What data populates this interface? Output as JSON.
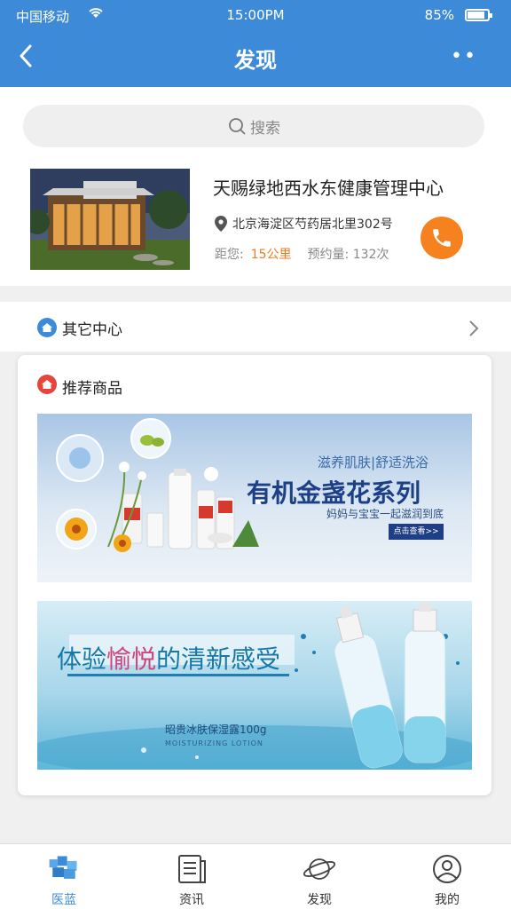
{
  "status_bar": {
    "carrier": "中国移动",
    "time": "15:00PM",
    "battery": "85%",
    "battery_level": 0.85
  },
  "nav": {
    "title": "发现",
    "more_label": "••"
  },
  "search": {
    "placeholder": "搜索"
  },
  "shop": {
    "name": "天赐绿地西水东健康管理中心",
    "address": "北京海淀区芍药居北里302号",
    "distance_label": "距您:",
    "distance_value": "15公里",
    "booking_label": "预约量:",
    "booking_value": "132次"
  },
  "other_centers": {
    "label": "其它中心"
  },
  "recommended": {
    "label": "推荐商品",
    "banner1": {
      "subtitle": "滋养肌肤|舒适洗浴",
      "title": "有机金盏花系列",
      "desc": "妈妈与宝宝一起滋润到底",
      "button": "点击查看>>"
    },
    "banner2": {
      "title_a": "体验",
      "title_b": "愉悦",
      "title_c": "的清新感受",
      "product": "昭贵冰肤保湿露100g",
      "product_en": "MOISTURIZING LOTION"
    }
  },
  "tabs": [
    {
      "label": "医蓝",
      "icon": "logo-icon",
      "active": true
    },
    {
      "label": "资讯",
      "icon": "news-icon",
      "active": false
    },
    {
      "label": "发现",
      "icon": "planet-icon",
      "active": false
    },
    {
      "label": "我的",
      "icon": "user-icon",
      "active": false
    }
  ],
  "colors": {
    "primary": "#3d8bd8",
    "accent": "#f5821f",
    "distance": "#f07a1c"
  }
}
